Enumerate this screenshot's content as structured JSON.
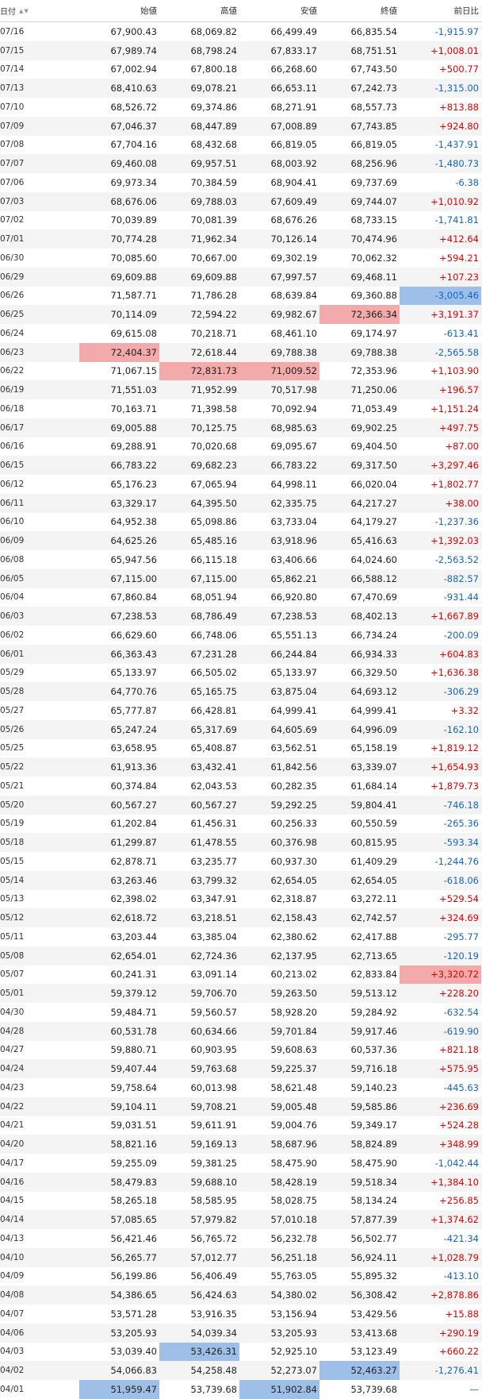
{
  "header": {
    "date": "日付",
    "open": "始値",
    "high": "高値",
    "low": "安値",
    "close": "終値",
    "change": "前日比",
    "sort_asc": "▲",
    "sort_desc": "▼"
  },
  "colors": {
    "up": "#e00000",
    "down": "#1565c0",
    "hl_red": "#f2aaaa",
    "hl_blue": "#9ec0e8"
  },
  "rows": [
    {
      "date": "07/16",
      "open": "67,900.43",
      "high": "68,069.82",
      "low": "66,499.49",
      "close": "66,835.54",
      "change": "-1,915.97",
      "dir": "neg"
    },
    {
      "date": "07/15",
      "open": "67,989.74",
      "high": "68,798.24",
      "low": "67,833.17",
      "close": "68,751.51",
      "change": "+1,008.01",
      "dir": "pos"
    },
    {
      "date": "07/14",
      "open": "67,002.94",
      "high": "67,800.18",
      "low": "66,268.60",
      "close": "67,743.50",
      "change": "+500.77",
      "dir": "pos"
    },
    {
      "date": "07/13",
      "open": "68,410.63",
      "high": "69,078.21",
      "low": "66,653.11",
      "close": "67,242.73",
      "change": "-1,315.00",
      "dir": "neg"
    },
    {
      "date": "07/10",
      "open": "68,526.72",
      "high": "69,374.86",
      "low": "68,271.91",
      "close": "68,557.73",
      "change": "+813.88",
      "dir": "pos"
    },
    {
      "date": "07/09",
      "open": "67,046.37",
      "high": "68,447.89",
      "low": "67,008.89",
      "close": "67,743.85",
      "change": "+924.80",
      "dir": "pos"
    },
    {
      "date": "07/08",
      "open": "67,704.16",
      "high": "68,432.68",
      "low": "66,819.05",
      "close": "66,819.05",
      "change": "-1,437.91",
      "dir": "neg"
    },
    {
      "date": "07/07",
      "open": "69,460.08",
      "high": "69,957.51",
      "low": "68,003.92",
      "close": "68,256.96",
      "change": "-1,480.73",
      "dir": "neg"
    },
    {
      "date": "07/06",
      "open": "69,973.34",
      "high": "70,384.59",
      "low": "68,904.41",
      "close": "69,737.69",
      "change": "-6.38",
      "dir": "neg"
    },
    {
      "date": "07/03",
      "open": "68,676.06",
      "high": "69,788.03",
      "low": "67,609.49",
      "close": "69,744.07",
      "change": "+1,010.92",
      "dir": "pos"
    },
    {
      "date": "07/02",
      "open": "70,039.89",
      "high": "70,081.39",
      "low": "68,676.26",
      "close": "68,733.15",
      "change": "-1,741.81",
      "dir": "neg"
    },
    {
      "date": "07/01",
      "open": "70,774.28",
      "high": "71,962.34",
      "low": "70,126.14",
      "close": "70,474.96",
      "change": "+412.64",
      "dir": "pos"
    },
    {
      "date": "06/30",
      "open": "70,085.60",
      "high": "70,667.00",
      "low": "69,302.19",
      "close": "70,062.32",
      "change": "+594.21",
      "dir": "pos"
    },
    {
      "date": "06/29",
      "open": "69,609.88",
      "high": "69,609.88",
      "low": "67,997.57",
      "close": "69,468.11",
      "change": "+107.23",
      "dir": "pos"
    },
    {
      "date": "06/26",
      "open": "71,587.71",
      "high": "71,786.28",
      "low": "68,639.84",
      "close": "69,360.88",
      "change": "-3,005.46",
      "dir": "neg",
      "hl": {
        "change": "blue"
      }
    },
    {
      "date": "06/25",
      "open": "70,114.09",
      "high": "72,594.22",
      "low": "69,982.67",
      "close": "72,366.34",
      "change": "+3,191.37",
      "dir": "pos",
      "hl": {
        "close": "red"
      }
    },
    {
      "date": "06/24",
      "open": "69,615.08",
      "high": "70,218.71",
      "low": "68,461.10",
      "close": "69,174.97",
      "change": "-613.41",
      "dir": "neg"
    },
    {
      "date": "06/23",
      "open": "72,404.37",
      "high": "72,618.44",
      "low": "69,788.38",
      "close": "69,788.38",
      "change": "-2,565.58",
      "dir": "neg",
      "hl": {
        "open": "red"
      }
    },
    {
      "date": "06/22",
      "open": "71,067.15",
      "high": "72,831.73",
      "low": "71,009.52",
      "close": "72,353.96",
      "change": "+1,103.90",
      "dir": "pos",
      "hl": {
        "high": "red",
        "low": "red"
      }
    },
    {
      "date": "06/19",
      "open": "71,551.03",
      "high": "71,952.99",
      "low": "70,517.98",
      "close": "71,250.06",
      "change": "+196.57",
      "dir": "pos"
    },
    {
      "date": "06/18",
      "open": "70,163.71",
      "high": "71,398.58",
      "low": "70,092.94",
      "close": "71,053.49",
      "change": "+1,151.24",
      "dir": "pos"
    },
    {
      "date": "06/17",
      "open": "69,005.88",
      "high": "70,125.75",
      "low": "68,985.63",
      "close": "69,902.25",
      "change": "+497.75",
      "dir": "pos"
    },
    {
      "date": "06/16",
      "open": "69,288.91",
      "high": "70,020.68",
      "low": "69,095.67",
      "close": "69,404.50",
      "change": "+87.00",
      "dir": "pos"
    },
    {
      "date": "06/15",
      "open": "66,783.22",
      "high": "69,682.23",
      "low": "66,783.22",
      "close": "69,317.50",
      "change": "+3,297.46",
      "dir": "pos"
    },
    {
      "date": "06/12",
      "open": "65,176.23",
      "high": "67,065.94",
      "low": "64,998.11",
      "close": "66,020.04",
      "change": "+1,802.77",
      "dir": "pos"
    },
    {
      "date": "06/11",
      "open": "63,329.17",
      "high": "64,395.50",
      "low": "62,335.75",
      "close": "64,217.27",
      "change": "+38.00",
      "dir": "pos"
    },
    {
      "date": "06/10",
      "open": "64,952.38",
      "high": "65,098.86",
      "low": "63,733.04",
      "close": "64,179.27",
      "change": "-1,237.36",
      "dir": "neg"
    },
    {
      "date": "06/09",
      "open": "64,625.26",
      "high": "65,485.16",
      "low": "63,918.96",
      "close": "65,416.63",
      "change": "+1,392.03",
      "dir": "pos"
    },
    {
      "date": "06/08",
      "open": "65,947.56",
      "high": "66,115.18",
      "low": "63,406.66",
      "close": "64,024.60",
      "change": "-2,563.52",
      "dir": "neg"
    },
    {
      "date": "06/05",
      "open": "67,115.00",
      "high": "67,115.00",
      "low": "65,862.21",
      "close": "66,588.12",
      "change": "-882.57",
      "dir": "neg"
    },
    {
      "date": "06/04",
      "open": "67,860.84",
      "high": "68,051.94",
      "low": "66,920.80",
      "close": "67,470.69",
      "change": "-931.44",
      "dir": "neg"
    },
    {
      "date": "06/03",
      "open": "67,238.53",
      "high": "68,786.49",
      "low": "67,238.53",
      "close": "68,402.13",
      "change": "+1,667.89",
      "dir": "pos"
    },
    {
      "date": "06/02",
      "open": "66,629.60",
      "high": "66,748.06",
      "low": "65,551.13",
      "close": "66,734.24",
      "change": "-200.09",
      "dir": "neg"
    },
    {
      "date": "06/01",
      "open": "66,363.43",
      "high": "67,231.28",
      "low": "66,244.84",
      "close": "66,934.33",
      "change": "+604.83",
      "dir": "pos"
    },
    {
      "date": "05/29",
      "open": "65,133.97",
      "high": "66,505.02",
      "low": "65,133.97",
      "close": "66,329.50",
      "change": "+1,636.38",
      "dir": "pos"
    },
    {
      "date": "05/28",
      "open": "64,770.76",
      "high": "65,165.75",
      "low": "63,875.04",
      "close": "64,693.12",
      "change": "-306.29",
      "dir": "neg"
    },
    {
      "date": "05/27",
      "open": "65,777.87",
      "high": "66,428.81",
      "low": "64,999.41",
      "close": "64,999.41",
      "change": "+3.32",
      "dir": "pos"
    },
    {
      "date": "05/26",
      "open": "65,247.24",
      "high": "65,317.69",
      "low": "64,605.69",
      "close": "64,996.09",
      "change": "-162.10",
      "dir": "neg"
    },
    {
      "date": "05/25",
      "open": "63,658.95",
      "high": "65,408.87",
      "low": "63,562.51",
      "close": "65,158.19",
      "change": "+1,819.12",
      "dir": "pos"
    },
    {
      "date": "05/22",
      "open": "61,913.36",
      "high": "63,432.41",
      "low": "61,842.56",
      "close": "63,339.07",
      "change": "+1,654.93",
      "dir": "pos"
    },
    {
      "date": "05/21",
      "open": "60,374.84",
      "high": "62,043.53",
      "low": "60,282.35",
      "close": "61,684.14",
      "change": "+1,879.73",
      "dir": "pos"
    },
    {
      "date": "05/20",
      "open": "60,567.27",
      "high": "60,567.27",
      "low": "59,292.25",
      "close": "59,804.41",
      "change": "-746.18",
      "dir": "neg"
    },
    {
      "date": "05/19",
      "open": "61,202.84",
      "high": "61,456.31",
      "low": "60,256.33",
      "close": "60,550.59",
      "change": "-265.36",
      "dir": "neg"
    },
    {
      "date": "05/18",
      "open": "61,299.87",
      "high": "61,478.55",
      "low": "60,376.98",
      "close": "60,815.95",
      "change": "-593.34",
      "dir": "neg"
    },
    {
      "date": "05/15",
      "open": "62,878.71",
      "high": "63,235.77",
      "low": "60,937.30",
      "close": "61,409.29",
      "change": "-1,244.76",
      "dir": "neg"
    },
    {
      "date": "05/14",
      "open": "63,263.46",
      "high": "63,799.32",
      "low": "62,654.05",
      "close": "62,654.05",
      "change": "-618.06",
      "dir": "neg"
    },
    {
      "date": "05/13",
      "open": "62,398.02",
      "high": "63,347.91",
      "low": "62,318.87",
      "close": "63,272.11",
      "change": "+529.54",
      "dir": "pos"
    },
    {
      "date": "05/12",
      "open": "62,618.72",
      "high": "63,218.51",
      "low": "62,158.43",
      "close": "62,742.57",
      "change": "+324.69",
      "dir": "pos"
    },
    {
      "date": "05/11",
      "open": "63,203.44",
      "high": "63,385.04",
      "low": "62,380.62",
      "close": "62,417.88",
      "change": "-295.77",
      "dir": "neg"
    },
    {
      "date": "05/08",
      "open": "62,654.01",
      "high": "62,724.36",
      "low": "62,137.95",
      "close": "62,713.65",
      "change": "-120.19",
      "dir": "neg"
    },
    {
      "date": "05/07",
      "open": "60,241.31",
      "high": "63,091.14",
      "low": "60,213.02",
      "close": "62,833.84",
      "change": "+3,320.72",
      "dir": "pos",
      "hl": {
        "change": "red"
      }
    },
    {
      "date": "05/01",
      "open": "59,379.12",
      "high": "59,706.70",
      "low": "59,263.50",
      "close": "59,513.12",
      "change": "+228.20",
      "dir": "pos"
    },
    {
      "date": "04/30",
      "open": "59,484.71",
      "high": "59,560.57",
      "low": "58,928.20",
      "close": "59,284.92",
      "change": "-632.54",
      "dir": "neg"
    },
    {
      "date": "04/28",
      "open": "60,531.78",
      "high": "60,634.66",
      "low": "59,701.84",
      "close": "59,917.46",
      "change": "-619.90",
      "dir": "neg"
    },
    {
      "date": "04/27",
      "open": "59,880.71",
      "high": "60,903.95",
      "low": "59,608.63",
      "close": "60,537.36",
      "change": "+821.18",
      "dir": "pos"
    },
    {
      "date": "04/24",
      "open": "59,407.44",
      "high": "59,763.68",
      "low": "59,225.37",
      "close": "59,716.18",
      "change": "+575.95",
      "dir": "pos"
    },
    {
      "date": "04/23",
      "open": "59,758.64",
      "high": "60,013.98",
      "low": "58,621.48",
      "close": "59,140.23",
      "change": "-445.63",
      "dir": "neg"
    },
    {
      "date": "04/22",
      "open": "59,104.11",
      "high": "59,708.21",
      "low": "59,005.48",
      "close": "59,585.86",
      "change": "+236.69",
      "dir": "pos"
    },
    {
      "date": "04/21",
      "open": "59,031.51",
      "high": "59,611.91",
      "low": "59,004.76",
      "close": "59,349.17",
      "change": "+524.28",
      "dir": "pos"
    },
    {
      "date": "04/20",
      "open": "58,821.16",
      "high": "59,169.13",
      "low": "58,687.96",
      "close": "58,824.89",
      "change": "+348.99",
      "dir": "pos"
    },
    {
      "date": "04/17",
      "open": "59,255.09",
      "high": "59,381.25",
      "low": "58,475.90",
      "close": "58,475.90",
      "change": "-1,042.44",
      "dir": "neg"
    },
    {
      "date": "04/16",
      "open": "58,479.83",
      "high": "59,688.10",
      "low": "58,428.19",
      "close": "59,518.34",
      "change": "+1,384.10",
      "dir": "pos"
    },
    {
      "date": "04/15",
      "open": "58,265.18",
      "high": "58,585.95",
      "low": "58,028.75",
      "close": "58,134.24",
      "change": "+256.85",
      "dir": "pos"
    },
    {
      "date": "04/14",
      "open": "57,085.65",
      "high": "57,979.82",
      "low": "57,010.18",
      "close": "57,877.39",
      "change": "+1,374.62",
      "dir": "pos"
    },
    {
      "date": "04/13",
      "open": "56,421.46",
      "high": "56,765.72",
      "low": "56,232.78",
      "close": "56,502.77",
      "change": "-421.34",
      "dir": "neg"
    },
    {
      "date": "04/10",
      "open": "56,265.77",
      "high": "57,012.77",
      "low": "56,251.18",
      "close": "56,924.11",
      "change": "+1,028.79",
      "dir": "pos"
    },
    {
      "date": "04/09",
      "open": "56,199.86",
      "high": "56,406.49",
      "low": "55,763.05",
      "close": "55,895.32",
      "change": "-413.10",
      "dir": "neg"
    },
    {
      "date": "04/08",
      "open": "54,386.65",
      "high": "56,424.63",
      "low": "54,380.02",
      "close": "56,308.42",
      "change": "+2,878.86",
      "dir": "pos"
    },
    {
      "date": "04/07",
      "open": "53,571.28",
      "high": "53,916.35",
      "low": "53,156.94",
      "close": "53,429.56",
      "change": "+15.88",
      "dir": "pos"
    },
    {
      "date": "04/06",
      "open": "53,205.93",
      "high": "54,039.34",
      "low": "53,205.93",
      "close": "53,413.68",
      "change": "+290.19",
      "dir": "pos"
    },
    {
      "date": "04/03",
      "open": "53,039.40",
      "high": "53,426.31",
      "low": "52,925.10",
      "close": "53,123.49",
      "change": "+660.22",
      "dir": "pos",
      "hl": {
        "high": "blue"
      }
    },
    {
      "date": "04/02",
      "open": "54,066.83",
      "high": "54,258.48",
      "low": "52,273.07",
      "close": "52,463.27",
      "change": "-1,276.41",
      "dir": "neg",
      "hl": {
        "close": "blue"
      }
    },
    {
      "date": "04/01",
      "open": "51,959.47",
      "high": "53,739.68",
      "low": "51,902.84",
      "close": "53,739.68",
      "change": "—",
      "dir": "flat",
      "hl": {
        "open": "blue",
        "low": "blue"
      }
    }
  ]
}
